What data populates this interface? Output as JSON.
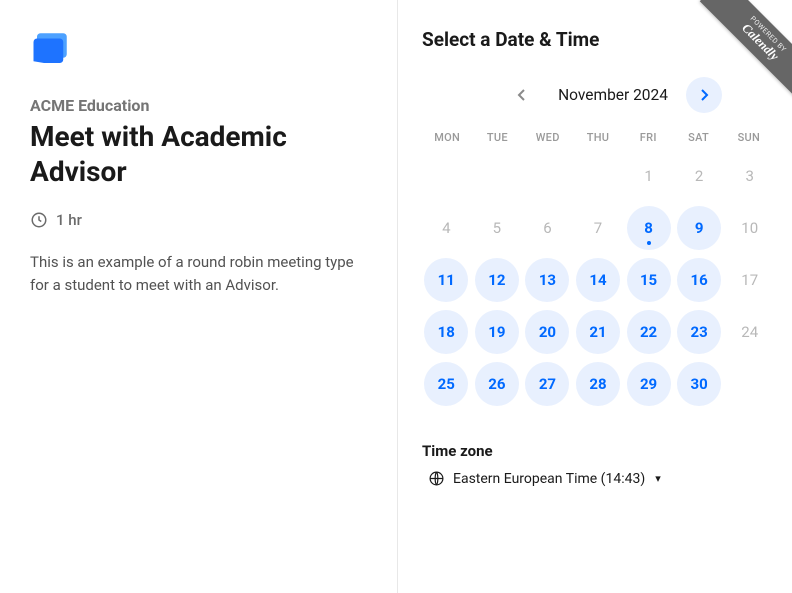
{
  "left": {
    "org": "ACME Education",
    "title": "Meet with Academic Advisor",
    "duration": "1 hr",
    "description": "This is an example of a round robin meeting type for a student to meet with an Advisor."
  },
  "right": {
    "heading": "Select a Date & Time",
    "month": "November 2024",
    "weekdays": [
      "MON",
      "TUE",
      "WED",
      "THU",
      "FRI",
      "SAT",
      "SUN"
    ],
    "days": [
      {
        "n": "",
        "s": "empty"
      },
      {
        "n": "",
        "s": "empty"
      },
      {
        "n": "",
        "s": "empty"
      },
      {
        "n": "",
        "s": "empty"
      },
      {
        "n": "1",
        "s": "dis"
      },
      {
        "n": "2",
        "s": "dis"
      },
      {
        "n": "3",
        "s": "dis"
      },
      {
        "n": "4",
        "s": "dis"
      },
      {
        "n": "5",
        "s": "dis"
      },
      {
        "n": "6",
        "s": "dis"
      },
      {
        "n": "7",
        "s": "dis"
      },
      {
        "n": "8",
        "s": "avail",
        "today": true
      },
      {
        "n": "9",
        "s": "avail"
      },
      {
        "n": "10",
        "s": "dis"
      },
      {
        "n": "11",
        "s": "avail"
      },
      {
        "n": "12",
        "s": "avail"
      },
      {
        "n": "13",
        "s": "avail"
      },
      {
        "n": "14",
        "s": "avail"
      },
      {
        "n": "15",
        "s": "avail"
      },
      {
        "n": "16",
        "s": "avail"
      },
      {
        "n": "17",
        "s": "dis"
      },
      {
        "n": "18",
        "s": "avail"
      },
      {
        "n": "19",
        "s": "avail"
      },
      {
        "n": "20",
        "s": "avail"
      },
      {
        "n": "21",
        "s": "avail"
      },
      {
        "n": "22",
        "s": "avail"
      },
      {
        "n": "23",
        "s": "avail"
      },
      {
        "n": "24",
        "s": "dis"
      },
      {
        "n": "25",
        "s": "avail"
      },
      {
        "n": "26",
        "s": "avail"
      },
      {
        "n": "27",
        "s": "avail"
      },
      {
        "n": "28",
        "s": "avail"
      },
      {
        "n": "29",
        "s": "avail"
      },
      {
        "n": "30",
        "s": "avail"
      }
    ],
    "tz_label": "Time zone",
    "tz_value": "Eastern European Time (14:43)"
  },
  "badge": {
    "powered": "POWERED BY",
    "name": "Calendly"
  }
}
